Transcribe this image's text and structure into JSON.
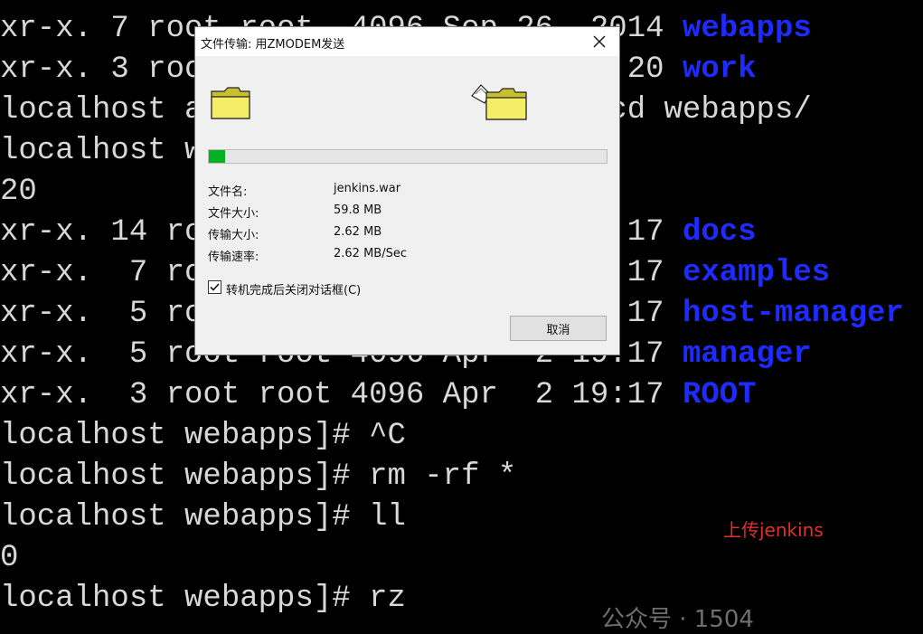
{
  "terminal": {
    "lines": [
      {
        "text": "xr-x. 7 root root  4096 Sep 26  2014 ",
        "hl": "webapps"
      },
      {
        "text": "xr-x. 3 root root  4096 Apr  2 19:20 ",
        "hl": "work"
      },
      {
        "text": "localhost apache-tomcat-8.0.15]# cd webapps/",
        "hl": ""
      },
      {
        "text": "localhost webapps]# ll",
        "hl": ""
      },
      {
        "text": "20",
        "hl": ""
      },
      {
        "text": "xr-x. 14 root root 4096 Apr  2 19:17 ",
        "hl": "docs"
      },
      {
        "text": "xr-x.  7 root root 4096 Apr  2 19:17 ",
        "hl": "examples"
      },
      {
        "text": "xr-x.  5 root root 4096 Apr  2 19:17 ",
        "hl": "host-manager"
      },
      {
        "text": "xr-x.  5 root root 4096 Apr  2 19:17 ",
        "hl": "manager"
      },
      {
        "text": "xr-x.  3 root root 4096 Apr  2 19:17 ",
        "hl": "ROOT"
      },
      {
        "text": "localhost webapps]# ^C",
        "hl": ""
      },
      {
        "text": "localhost webapps]# rm -rf *",
        "hl": ""
      },
      {
        "text": "localhost webapps]# ll",
        "hl": ""
      },
      {
        "text": "0",
        "hl": ""
      },
      {
        "text": "localhost webapps]# rz",
        "hl": ""
      }
    ]
  },
  "annotation": "上传jenkins",
  "watermark": "公众号 · 1504",
  "dialog": {
    "title": "文件传输: 用ZMODEM发送",
    "progress": 0.04,
    "info": [
      {
        "label": "文件名:",
        "value": "jenkins.war"
      },
      {
        "label": "文件大小:",
        "value": "59.8 MB"
      },
      {
        "label": "传输大小:",
        "value": "2.62 MB"
      },
      {
        "label": "传输速率:",
        "value": "2.62 MB/Sec"
      }
    ],
    "checkbox_label": "转机完成后关闭对话框(C)",
    "checkbox_checked": true,
    "cancel_label": "取消"
  },
  "colors": {
    "terminal_bg": "#000000",
    "terminal_text": "#d8d8d8",
    "dir_highlight": "#1e2bff",
    "progress_fill": "#06b025",
    "annotation": "#e0312a"
  },
  "icons": [
    "folder-icon",
    "folder-send-icon",
    "close-icon",
    "check-icon"
  ]
}
